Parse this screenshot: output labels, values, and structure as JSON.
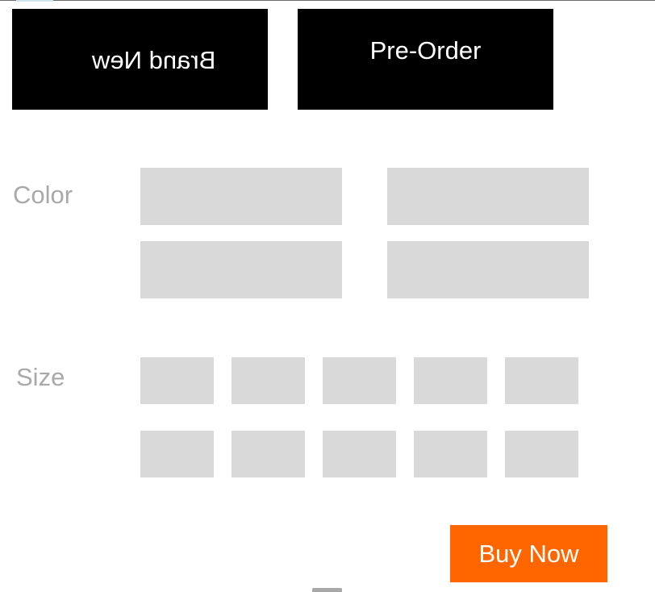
{
  "condition": {
    "options": [
      {
        "label": "Brand New"
      },
      {
        "label": "Pre-Order"
      }
    ]
  },
  "color": {
    "label": "Color",
    "swatch_count": 4
  },
  "size": {
    "label": "Size",
    "swatch_count": 10
  },
  "actions": {
    "buy_now": "Buy Now"
  },
  "colors": {
    "condition_button_bg": "#000000",
    "condition_button_text": "#ffffff",
    "placeholder_swatch": "#d9d9d9",
    "label_text": "#a9a9a9",
    "buy_button_bg": "#ff6600",
    "buy_button_text": "#ffffff"
  }
}
